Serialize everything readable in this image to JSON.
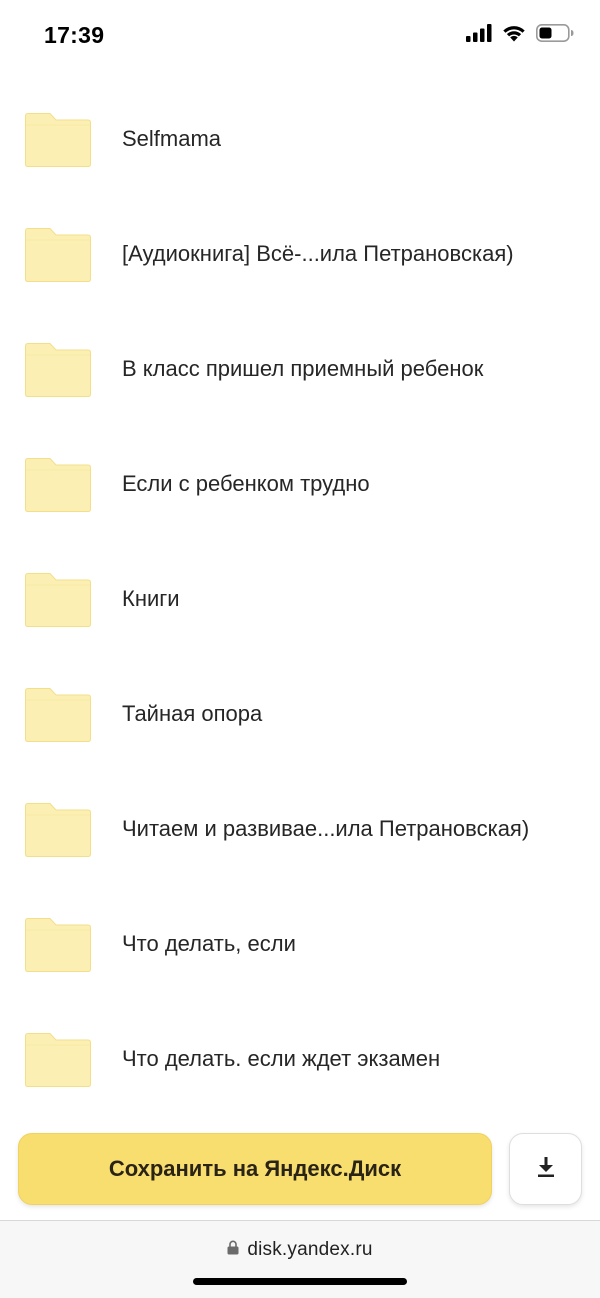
{
  "status_bar": {
    "time": "17:39",
    "icons": [
      "signal-icon",
      "wifi-icon",
      "battery-icon"
    ]
  },
  "folders": [
    {
      "name": "Selfmama",
      "icon": "folder-icon"
    },
    {
      "name": "[Аудиокнига] Всё-...ила Петрановская)",
      "icon": "folder-icon"
    },
    {
      "name": "В класс пришел приемный ребенок",
      "icon": "folder-icon"
    },
    {
      "name": "Если с ребенком трудно",
      "icon": "folder-icon"
    },
    {
      "name": "Книги",
      "icon": "folder-icon"
    },
    {
      "name": "Тайная опора",
      "icon": "folder-icon"
    },
    {
      "name": "Читаем и развивае...ила Петрановская)",
      "icon": "folder-icon"
    },
    {
      "name": "Что делать, если",
      "icon": "folder-icon"
    },
    {
      "name": "Что делать. если ждет экзамен",
      "icon": "folder-icon"
    }
  ],
  "actions": {
    "save_label": "Сохранить на Яндекс.Диск",
    "download_icon": "download-icon"
  },
  "browser": {
    "url": "disk.yandex.ru",
    "lock_icon": "lock-icon"
  },
  "colors": {
    "folder_fill": "#fcefb4",
    "folder_stroke": "#f3df8a",
    "save_button": "#f8dd6f"
  }
}
